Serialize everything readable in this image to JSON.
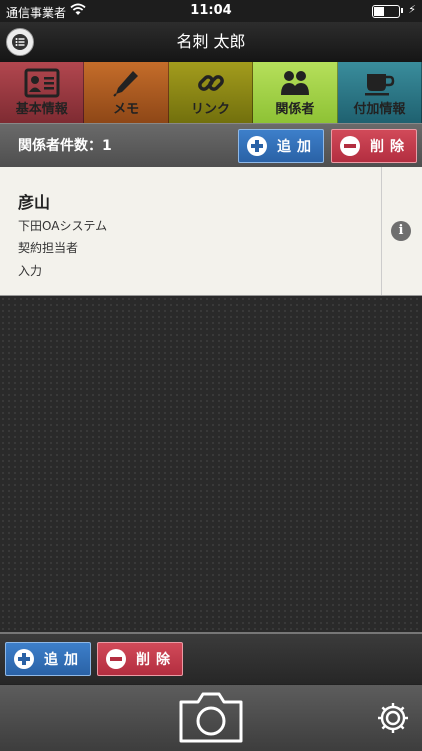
{
  "status_bar": {
    "carrier": "通信事業者",
    "time": "11:04"
  },
  "nav": {
    "title": "名刺 太郎"
  },
  "tabs": [
    {
      "label": "基本情報",
      "icon": "id-card-icon"
    },
    {
      "label": "メモ",
      "icon": "pen-icon"
    },
    {
      "label": "リンク",
      "icon": "link-icon"
    },
    {
      "label": "関係者",
      "icon": "people-icon"
    },
    {
      "label": "付加情報",
      "icon": "cup-icon"
    }
  ],
  "related": {
    "count_label": "関係者件数：1",
    "add_label": "追加",
    "delete_label": "削除"
  },
  "contacts": [
    {
      "name": "彦山",
      "company": "下田OAシステム",
      "role": "契約担当者",
      "note": "入力"
    }
  ],
  "bottom": {
    "add_label": "追加",
    "delete_label": "削除"
  },
  "colors": {
    "tab_basic": "#9b3a42",
    "tab_memo": "#aa5a20",
    "tab_link": "#8c8717",
    "tab_related": "#a4d24a",
    "tab_extra": "#2c7888",
    "add_button": "#3371ba",
    "delete_button": "#c23c4e"
  }
}
